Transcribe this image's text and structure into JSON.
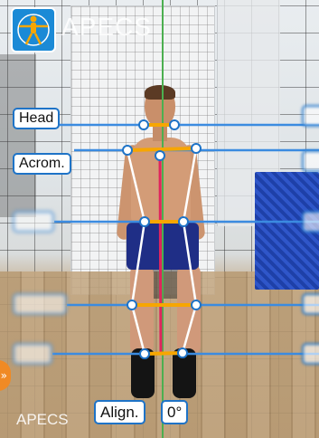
{
  "app": {
    "title": "APECS",
    "footer_brand": "APECS"
  },
  "landmarks": {
    "head_label": "Head",
    "acromion_label": "Acrom.",
    "hips_label": "",
    "knees_label": "",
    "feet_label": ""
  },
  "controls": {
    "align_label": "Align.",
    "angle_value": "0°",
    "side_handle_glyph": "»"
  },
  "icons": {
    "logo": "vitruvian-man-icon",
    "side_handle": "double-chevron-right-icon"
  },
  "colors": {
    "reference_line": "#4caf50",
    "center_line": "#e0245e",
    "level_line": "#3b8be0",
    "segment_highlight": "#f7a600",
    "skeleton": "#ffffff",
    "label_border": "#1e73c7",
    "logo_bg": "#1b8ad6"
  }
}
